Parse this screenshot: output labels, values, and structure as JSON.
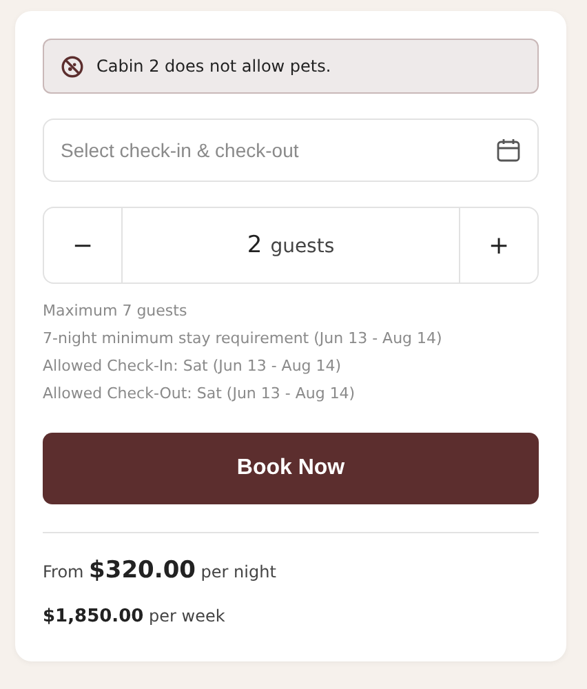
{
  "alert": {
    "text": "Cabin 2 does not allow pets."
  },
  "dates": {
    "placeholder": "Select check-in & check-out"
  },
  "guests": {
    "decrement": "−",
    "count": "2",
    "unit": "guests",
    "increment": "+"
  },
  "notes": [
    "Maximum 7 guests",
    "7-night minimum stay requirement (Jun 13 - Aug 14)",
    "Allowed Check-In: Sat (Jun 13 - Aug 14)",
    "Allowed Check-Out: Sat (Jun 13 - Aug 14)"
  ],
  "book_button": "Book Now",
  "prices": [
    "From **$320.00** per night",
    "**$1,850.00** per week"
  ]
}
